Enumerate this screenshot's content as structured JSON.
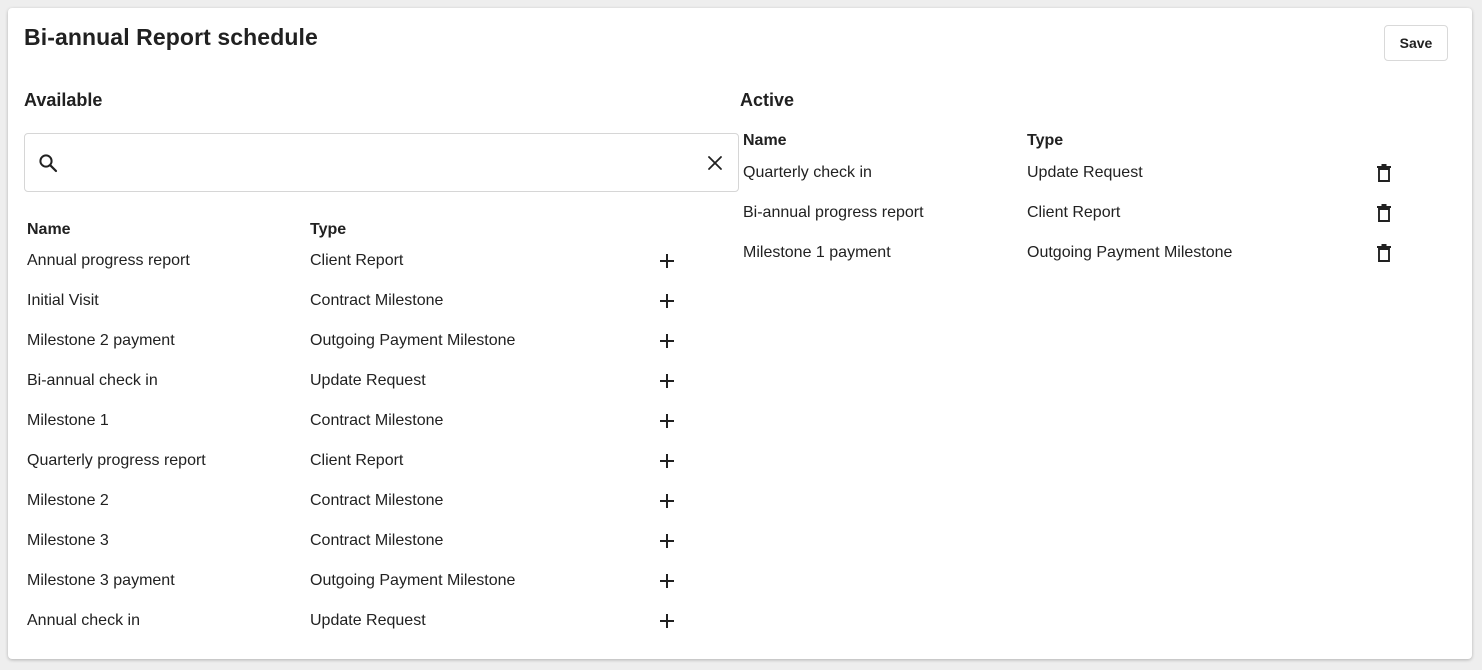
{
  "page": {
    "title": "Bi-annual Report schedule",
    "save_label": "Save"
  },
  "available": {
    "title": "Available",
    "search": {
      "value": "",
      "placeholder": ""
    },
    "columns": {
      "name": "Name",
      "type": "Type"
    },
    "rows": [
      {
        "name": "Annual progress report",
        "type": "Client Report"
      },
      {
        "name": "Initial Visit",
        "type": "Contract Milestone"
      },
      {
        "name": "Milestone 2 payment",
        "type": "Outgoing Payment Milestone"
      },
      {
        "name": "Bi-annual check in",
        "type": "Update Request"
      },
      {
        "name": "Milestone 1",
        "type": "Contract Milestone"
      },
      {
        "name": "Quarterly progress report",
        "type": "Client Report"
      },
      {
        "name": "Milestone 2",
        "type": "Contract Milestone"
      },
      {
        "name": "Milestone 3",
        "type": "Contract Milestone"
      },
      {
        "name": "Milestone 3 payment",
        "type": "Outgoing Payment Milestone"
      },
      {
        "name": "Annual check in",
        "type": "Update Request"
      }
    ],
    "row_action_icon": "plus-icon"
  },
  "active": {
    "title": "Active",
    "columns": {
      "name": "Name",
      "type": "Type"
    },
    "rows": [
      {
        "name": "Quarterly check in",
        "type": "Update Request"
      },
      {
        "name": "Bi-annual progress report",
        "type": "Client Report"
      },
      {
        "name": "Milestone 1 payment",
        "type": "Outgoing Payment Milestone"
      }
    ],
    "row_action_icon": "trash-icon"
  },
  "icons": {
    "search": "search-icon",
    "clear": "close-icon"
  },
  "colors": {
    "background": "#eeeeee",
    "card": "#ffffff",
    "text": "#212121",
    "border": "#d6d6d6"
  }
}
